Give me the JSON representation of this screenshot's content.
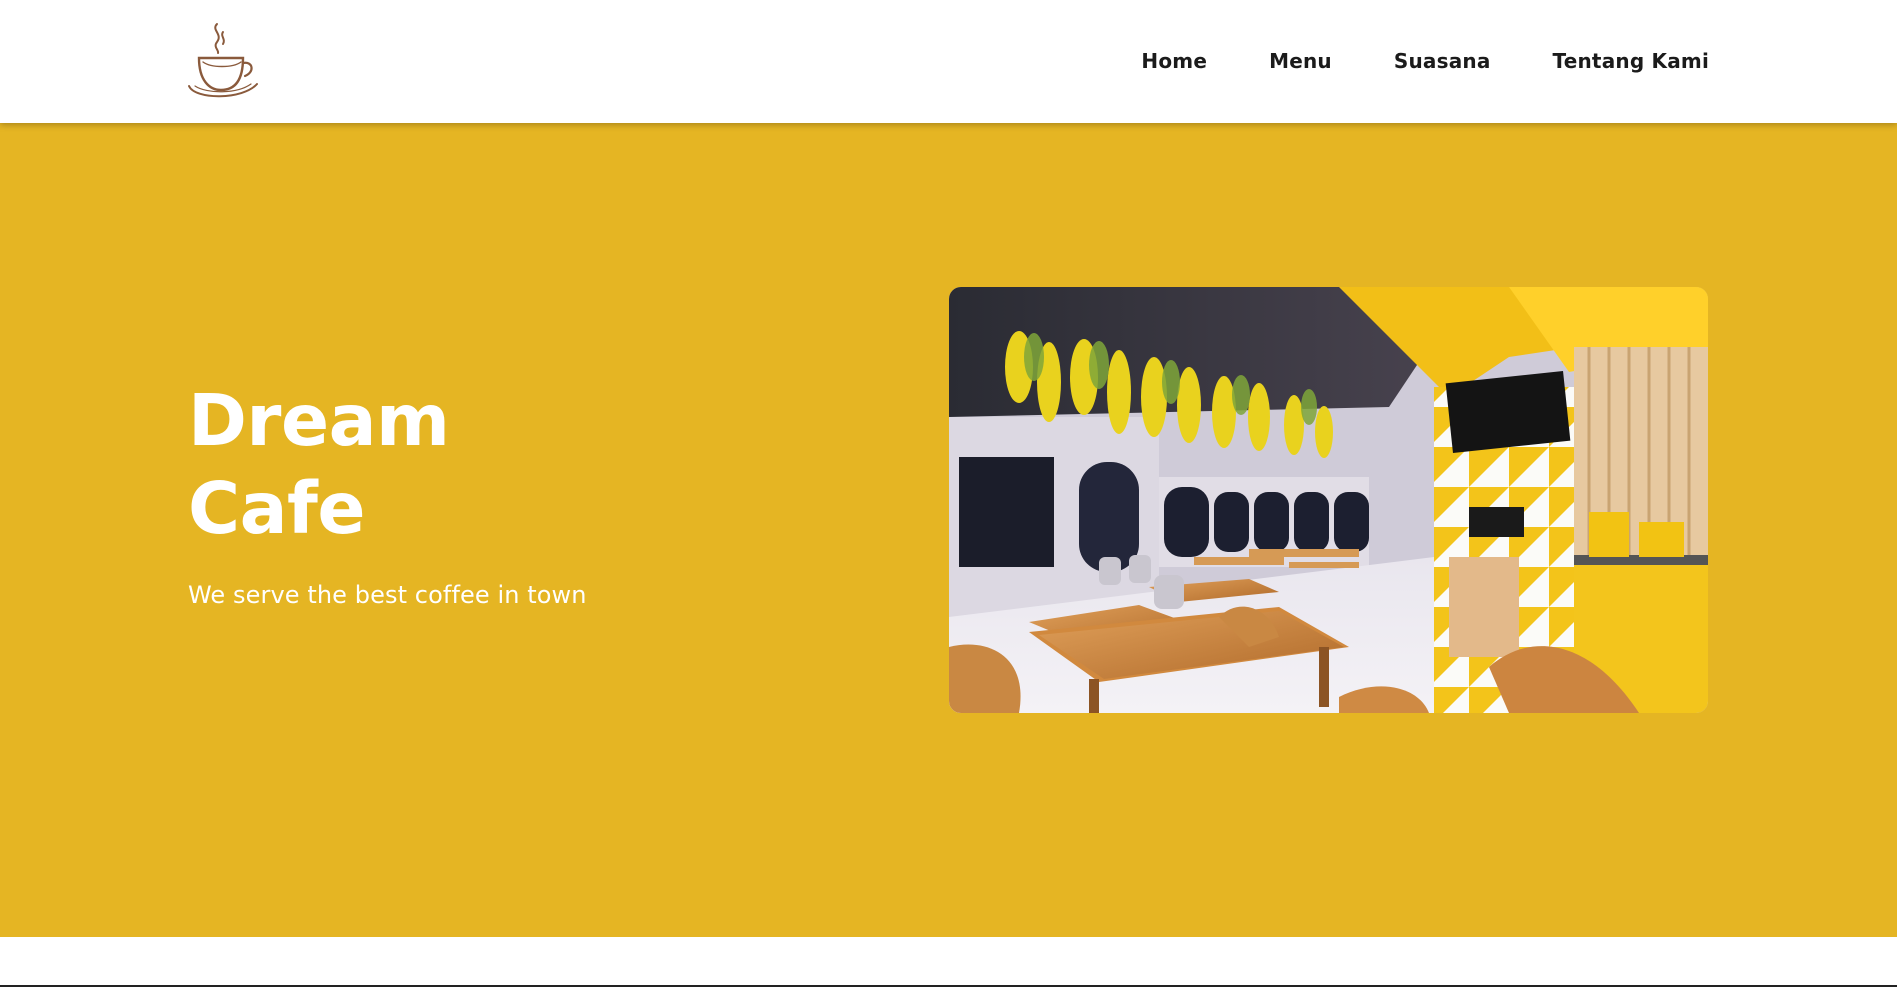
{
  "brand": {
    "logo_icon": "coffee-cup-logo-icon",
    "logo_color": "#8a5a3c"
  },
  "nav": {
    "items": [
      {
        "label": "Home"
      },
      {
        "label": "Menu"
      },
      {
        "label": "Suasana"
      },
      {
        "label": "Tentang Kami"
      }
    ]
  },
  "hero": {
    "title_line1": "Dream",
    "title_line2": "Cafe",
    "subtitle": "We serve the best coffee in town",
    "background_color": "#e5b523",
    "image_icon": "cafe-interior-photo"
  }
}
